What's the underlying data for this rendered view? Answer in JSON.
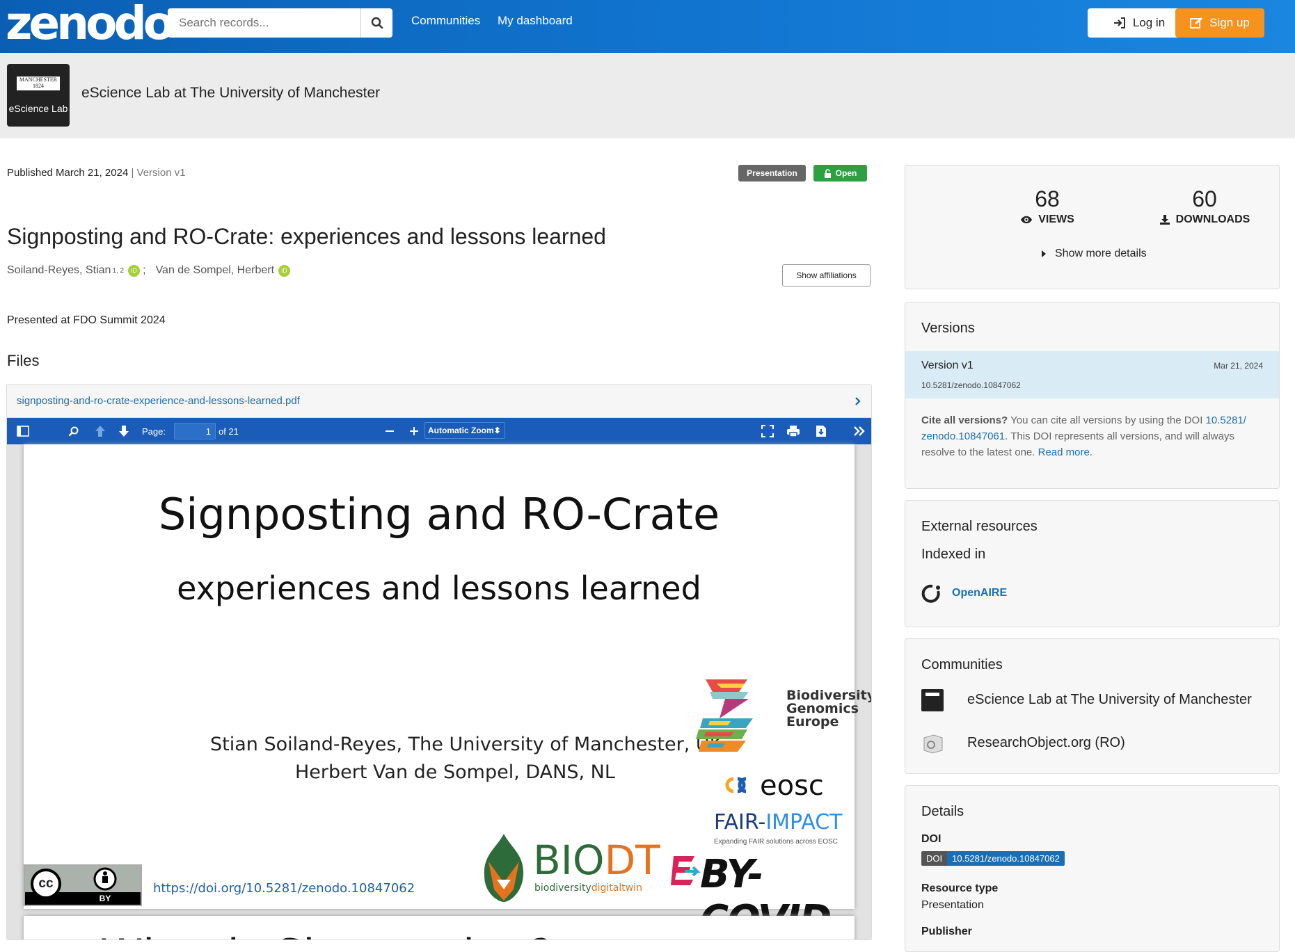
{
  "header": {
    "logo_text": "zenodo",
    "search_placeholder": "Search records...",
    "nav": [
      "Communities",
      "My dashboard"
    ],
    "login_label": "Log in",
    "signup_label": "Sign up"
  },
  "community": {
    "logo_top": "MANCHESTER 1824",
    "logo_sub": "The University of Manchester",
    "logo_text": "eScience Lab",
    "name": "eScience Lab at The University of Manchester"
  },
  "record": {
    "published": "Published March 21, 2024",
    "separator": "|",
    "version": "Version v1",
    "badge_type": "Presentation",
    "badge_access": "Open",
    "title": "Signposting and RO-Crate: experiences and lessons learned",
    "author1": "Soiland-Reyes, Stian",
    "author1_sup": "1, 2",
    "author_sep": ";",
    "author2": "Van de Sompel, Herbert",
    "show_affiliations": "Show affiliations",
    "description": "Presented at FDO Summit 2024"
  },
  "files": {
    "heading": "Files",
    "filename": "signposting-and-ro-crate-experience-and-lessons-learned.pdf",
    "viewer": {
      "page_label": "Page:",
      "page_value": "1",
      "page_total": "of 21",
      "zoom": "Automatic Zoom"
    },
    "slide": {
      "title": "Signposting and RO-Crate",
      "subtitle": "experiences and lessons learned",
      "authors_line1": "Stian Soiland-Reyes, The University of Manchester, UK",
      "authors_line2": "Herbert Van de Sompel, DANS, NL",
      "doi_link": "https://doi.org/10.5281/zenodo.10847062",
      "bge": [
        "Biodiversity",
        "Genomics",
        "Europe"
      ],
      "eosc": "eosc",
      "fair_a": "FAIR-",
      "fair_b": "IMPACT",
      "fair_tag": "Expanding FAIR solutions across EOSC",
      "biodt": "BIODT",
      "biodt_a": "biodiversity",
      "biodt_b": "digitaltwin",
      "bycovid": "BY-COVID",
      "cc": "cc",
      "by": "BY",
      "next_title": "What is Signposting?"
    }
  },
  "stats": {
    "views": "68",
    "views_label": "VIEWS",
    "downloads": "60",
    "downloads_label": "DOWNLOADS",
    "more": "Show more details"
  },
  "versions": {
    "heading": "Versions",
    "item_label": "Version v1",
    "item_date": "Mar 21, 2024",
    "item_doi": "10.5281/zenodo.10847062",
    "cite_q": "Cite all versions?",
    "cite_text1": "You can cite all versions by using the DOI",
    "cite_doi_a": "10.5281/",
    "cite_doi_b": "zenodo.10847061",
    "cite_text2": ". This DOI represents all versions, and will always",
    "cite_text3": "resolve to the latest one.",
    "read_more": "Read more."
  },
  "external": {
    "heading": "External resources",
    "indexed": "Indexed in",
    "openaire": "OpenAIRE"
  },
  "communities": {
    "heading": "Communities",
    "items": [
      "eScience Lab at The University of Manchester",
      "ResearchObject.org (RO)"
    ]
  },
  "details": {
    "heading": "Details",
    "doi_label": "DOI",
    "doi_badge_l": "DOI",
    "doi_badge_r": "10.5281/zenodo.10847062",
    "resource_type_label": "Resource type",
    "resource_type": "Presentation",
    "publisher_label": "Publisher"
  },
  "colors": {
    "header_blue": "#1277d2",
    "signup_orange": "#f6921e",
    "open_green": "#2ea043",
    "presentation_grey": "#666666",
    "link_blue": "#1a6eb5",
    "pdf_toolbar": "#1a5cb8"
  }
}
